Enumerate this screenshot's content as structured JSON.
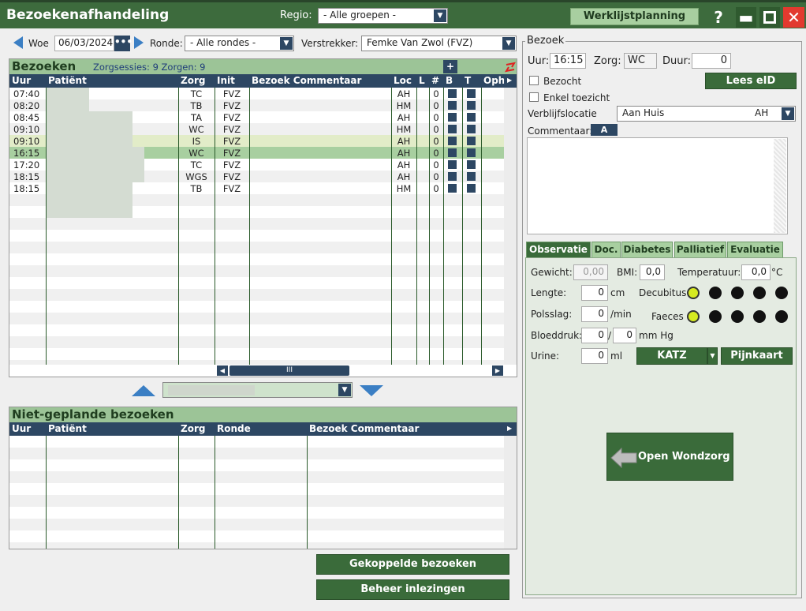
{
  "window": {
    "title": "Bezoekenafhandeling",
    "regio_label": "Regio:",
    "regio_value": "- Alle groepen -",
    "werklijst_btn": "Werklijstplanning",
    "help": "?"
  },
  "toolbar": {
    "day": "Woe",
    "date": "06/03/2024",
    "ronde_label": "Ronde:",
    "ronde_value": "- Alle rondes -",
    "verstrekker_label": "Verstrekker:",
    "verstrekker_value": "Femke Van Zwol (FVZ)"
  },
  "bezoeken": {
    "title": "Bezoeken",
    "summary": "Zorgsessies: 9 Zorgen: 9",
    "add": "+",
    "columns": [
      "Uur",
      "Patiënt",
      "Zorg",
      "Init",
      "Bezoek Commentaar",
      "Loc",
      "L",
      "#",
      "B",
      "T",
      "Oph"
    ],
    "rows": [
      {
        "uur": "07:40",
        "zorg": "TC",
        "init": "FVZ",
        "loc": "AH",
        "count": "0"
      },
      {
        "uur": "08:20",
        "zorg": "TB",
        "init": "FVZ",
        "loc": "HM",
        "count": "0"
      },
      {
        "uur": "08:45",
        "zorg": "TA",
        "init": "FVZ",
        "loc": "AH",
        "count": "0"
      },
      {
        "uur": "09:10",
        "zorg": "WC",
        "init": "FVZ",
        "loc": "HM",
        "count": "0"
      },
      {
        "uur": "09:10",
        "zorg": "IS",
        "init": "FVZ",
        "loc": "AH",
        "count": "0"
      },
      {
        "uur": "16:15",
        "zorg": "WC",
        "init": "FVZ",
        "loc": "AH",
        "count": "0"
      },
      {
        "uur": "17:20",
        "zorg": "TC",
        "init": "FVZ",
        "loc": "AH",
        "count": "0"
      },
      {
        "uur": "18:15",
        "zorg": "WGS",
        "init": "FVZ",
        "loc": "AH",
        "count": "0"
      },
      {
        "uur": "18:15",
        "zorg": "TB",
        "init": "FVZ",
        "loc": "HM",
        "count": "0"
      }
    ],
    "scroll_grip": "III"
  },
  "niet_gepland": {
    "title": "Niet-geplande bezoeken",
    "columns": [
      "Uur",
      "Patiënt",
      "Zorg",
      "Ronde",
      "Bezoek Commentaar"
    ]
  },
  "buttons": {
    "gekoppelde": "Gekoppelde bezoeken",
    "beheer": "Beheer inlezingen"
  },
  "bezoek": {
    "legend": "Bezoek",
    "uur_label": "Uur:",
    "uur": "16:15",
    "zorg_label": "Zorg:",
    "zorg": "WC",
    "duur_label": "Duur:",
    "duur": "0",
    "bezocht": "Bezocht",
    "lees_eid": "Lees eID",
    "enkel": "Enkel toezicht",
    "verblijf_label": "Verblijfslocatie",
    "verblijf_value": "Aan Huis",
    "verblijf_code": "AH",
    "commentaar_label": "Commentaar:",
    "commentaar_btn": "A"
  },
  "tabs": [
    "Observatie",
    "Doc.",
    "Diabetes",
    "Palliatief",
    "Evaluatie"
  ],
  "observatie": {
    "gewicht_label": "Gewicht:",
    "gewicht": "0,00",
    "bmi_label": "BMI:",
    "bmi": "0,0",
    "temp_label": "Temperatuur:",
    "temp": "0,0",
    "temp_unit": "°C",
    "lengte_label": "Lengte:",
    "lengte": "0",
    "lengte_unit": "cm",
    "decubitus_label": "Decubitus",
    "polsslag_label": "Polsslag:",
    "polsslag": "0",
    "polsslag_unit": "/min",
    "faeces_label": "Faeces",
    "bloeddruk_label": "Bloeddruk:",
    "bd1": "0",
    "bd_sep": "/",
    "bd2": "0",
    "bd_unit": "mm Hg",
    "urine_label": "Urine:",
    "urine": "0",
    "urine_unit": "ml",
    "katz": "KATZ",
    "pijnkaart": "Pijnkaart",
    "wondzorg": "Open Wondzorg"
  }
}
